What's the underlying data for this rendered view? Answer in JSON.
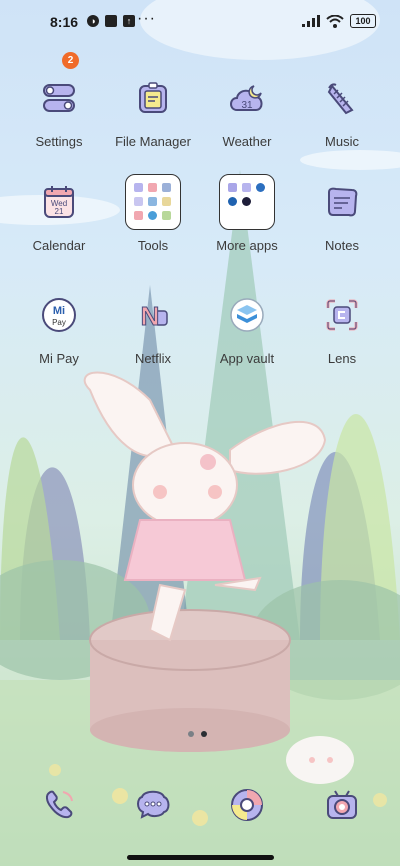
{
  "status": {
    "time": "8:16",
    "battery": "100",
    "icons": [
      "pixel-icon",
      "square-icon",
      "upload-icon",
      "more-dots"
    ]
  },
  "grid": [
    {
      "label": "Settings",
      "icon": "settings-toggle-icon",
      "badge": "2"
    },
    {
      "label": "File Manager",
      "icon": "file-manager-icon"
    },
    {
      "label": "Weather",
      "icon": "weather-cloud-moon-icon",
      "icon_text": "31"
    },
    {
      "label": "Music",
      "icon": "music-lyre-icon"
    },
    {
      "label": "Calendar",
      "icon": "calendar-icon",
      "icon_text": "Wed",
      "icon_text2": "21"
    },
    {
      "label": "Tools",
      "icon": "tools-folder"
    },
    {
      "label": "More apps",
      "icon": "more-apps-folder"
    },
    {
      "label": "Notes",
      "icon": "notes-icon"
    },
    {
      "label": "Mi Pay",
      "icon": "mi-pay-icon",
      "icon_text": "Mi",
      "icon_text2": "Pay"
    },
    {
      "label": "Netflix",
      "icon": "netflix-icon",
      "icon_text": "N"
    },
    {
      "label": "App vault",
      "icon": "app-vault-icon"
    },
    {
      "label": "Lens",
      "icon": "lens-scan-icon"
    }
  ],
  "dock": [
    {
      "icon": "phone-icon"
    },
    {
      "icon": "messages-icon"
    },
    {
      "icon": "browser-icon"
    },
    {
      "icon": "camera-icon"
    }
  ],
  "page_indicator": {
    "count": 2,
    "active": 1
  },
  "colors": {
    "icon_line": "#4a4a7a",
    "accent_purple": "#a9a6e8",
    "accent_pink": "#f1a7b0",
    "badge": "#f06b2a"
  }
}
